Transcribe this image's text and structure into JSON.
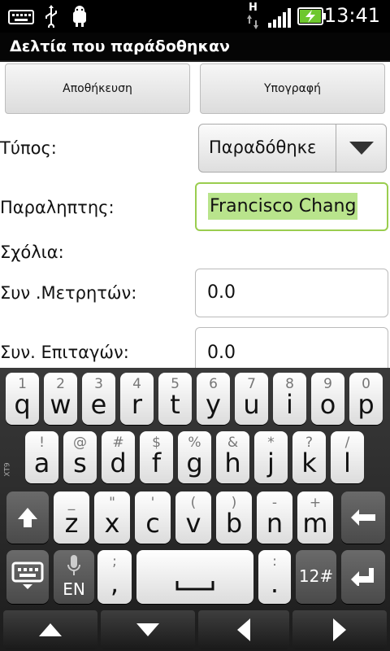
{
  "statusbar": {
    "time": "13:41",
    "network_label": "H"
  },
  "titlebar": {
    "title": "Δελτία που παράδοθηκαν"
  },
  "buttons": {
    "save": "Αποθήκευση",
    "signature": "Υπογραφή"
  },
  "form": {
    "type_label": "Τύπος:",
    "type_value": "Παραδόθηκε",
    "recipient_label": "Παραληπτης:",
    "recipient_value": "Francisco Chang",
    "comments_label": "Σχόλια:",
    "meters_label": "Συν .Μετρητών:",
    "meters_value": "0.0",
    "orders_label": "Συν. Επιταγών:",
    "orders_value": "0.0"
  },
  "keyboard": {
    "brand_label": "XT9",
    "row1": [
      {
        "sym": "1",
        "main": "q"
      },
      {
        "sym": "2",
        "main": "w"
      },
      {
        "sym": "3",
        "main": "e"
      },
      {
        "sym": "4",
        "main": "r"
      },
      {
        "sym": "5",
        "main": "t"
      },
      {
        "sym": "6",
        "main": "y"
      },
      {
        "sym": "7",
        "main": "u"
      },
      {
        "sym": "8",
        "main": "i"
      },
      {
        "sym": "9",
        "main": "o"
      },
      {
        "sym": "0",
        "main": "p"
      }
    ],
    "row2": [
      {
        "sym": "!",
        "main": "a"
      },
      {
        "sym": "@",
        "main": "s"
      },
      {
        "sym": "#",
        "main": "d"
      },
      {
        "sym": "$",
        "main": "f"
      },
      {
        "sym": "%",
        "main": "g"
      },
      {
        "sym": "&",
        "main": "h"
      },
      {
        "sym": "*",
        "main": "j"
      },
      {
        "sym": "?",
        "main": "k"
      },
      {
        "sym": "/",
        "main": "l"
      }
    ],
    "row3": [
      {
        "sym": "_",
        "main": "z"
      },
      {
        "sym": "\"",
        "main": "x"
      },
      {
        "sym": "'",
        "main": "c"
      },
      {
        "sym": "(",
        "main": "v"
      },
      {
        "sym": ")",
        "main": "b"
      },
      {
        "sym": "-",
        "main": "n"
      },
      {
        "sym": "+",
        "main": "m"
      }
    ],
    "lang_label": "EN",
    "comma_sym": ";",
    "comma_main": ",",
    "period_sym": ":",
    "period_main": ".",
    "numbers_label": "12#"
  }
}
